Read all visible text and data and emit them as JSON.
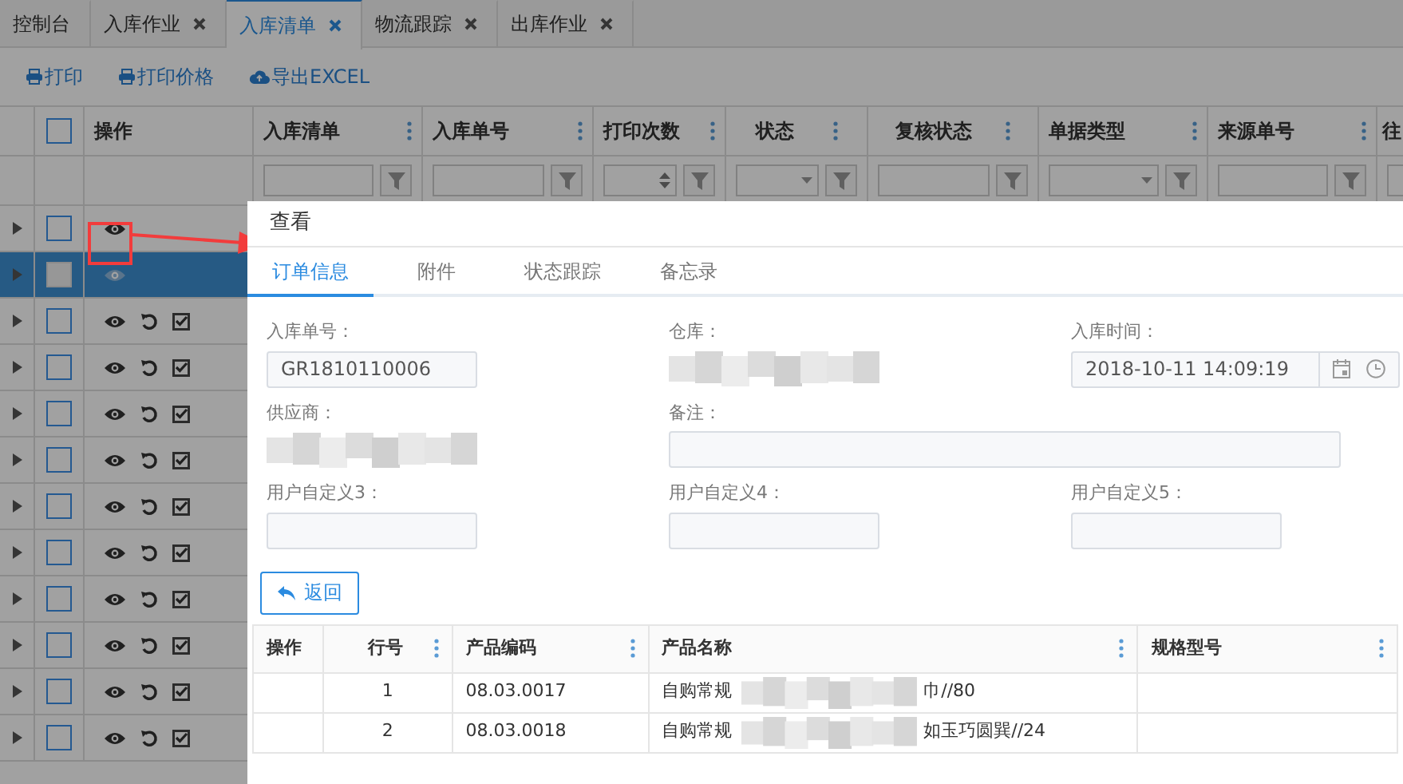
{
  "tabs": [
    {
      "label": "控制台",
      "closable": false,
      "selected": false
    },
    {
      "label": "入库作业",
      "closable": true,
      "selected": false
    },
    {
      "label": "入库清单",
      "closable": true,
      "selected": true
    },
    {
      "label": "物流跟踪",
      "closable": true,
      "selected": false
    },
    {
      "label": "出库作业",
      "closable": true,
      "selected": false
    }
  ],
  "toolbar": [
    {
      "label": "打印",
      "kind": "print"
    },
    {
      "label": "打印价格",
      "kind": "print"
    },
    {
      "label": "导出EXCEL",
      "kind": "export"
    }
  ],
  "grid": {
    "all_checked": false,
    "columns": [
      {
        "label": "操作",
        "kind": "plain"
      },
      {
        "label": "入库清单",
        "kind": "text"
      },
      {
        "label": "入库单号",
        "kind": "text"
      },
      {
        "label": "打印次数",
        "kind": "number"
      },
      {
        "label": "状态",
        "kind": "select"
      },
      {
        "label": "复核状态",
        "kind": "text"
      },
      {
        "label": "单据类型",
        "kind": "select"
      },
      {
        "label": "来源单号",
        "kind": "text"
      },
      {
        "label": "往",
        "kind": "text"
      }
    ],
    "rows": [
      {
        "kind": "view_only",
        "selected": false,
        "highlighted": true
      },
      {
        "kind": "view_only",
        "selected": true,
        "highlighted": false
      },
      {
        "kind": "full",
        "selected": false,
        "highlighted": false
      },
      {
        "kind": "full",
        "selected": false,
        "highlighted": false
      },
      {
        "kind": "full",
        "selected": false,
        "highlighted": false
      },
      {
        "kind": "full",
        "selected": false,
        "highlighted": false
      },
      {
        "kind": "full",
        "selected": false,
        "highlighted": false
      },
      {
        "kind": "full",
        "selected": false,
        "highlighted": false
      },
      {
        "kind": "full",
        "selected": false,
        "highlighted": false
      },
      {
        "kind": "full",
        "selected": false,
        "highlighted": false
      },
      {
        "kind": "full",
        "selected": false,
        "highlighted": false
      },
      {
        "kind": "full",
        "selected": false,
        "highlighted": false
      }
    ]
  },
  "dialog": {
    "title": "查看",
    "tabs": [
      {
        "label": "订单信息",
        "selected": true
      },
      {
        "label": "附件",
        "selected": false
      },
      {
        "label": "状态跟踪",
        "selected": false
      },
      {
        "label": "备忘录",
        "selected": false
      }
    ],
    "fields": [
      {
        "label": "入库单号：",
        "kind": "text",
        "value": "GR1810110006"
      },
      {
        "label": "仓库：",
        "kind": "redacted"
      },
      {
        "label": "入库时间：",
        "kind": "datetime",
        "value": "2018-10-11 14:09:19"
      },
      {
        "label": "供应商：",
        "kind": "redacted"
      },
      {
        "label": "备注：",
        "kind": "wide"
      },
      {
        "label": "用户自定义3：",
        "kind": "text"
      },
      {
        "label": "用户自定义4：",
        "kind": "text"
      },
      {
        "label": "用户自定义5：",
        "kind": "text"
      }
    ],
    "back_button": "返回",
    "table": {
      "columns": [
        "操作",
        "行号",
        "产品编码",
        "产品名称",
        "规格型号"
      ],
      "rows": [
        {
          "line": "1",
          "code": "08.03.0017",
          "name_start": "自购常规",
          "name_end": "巾//80"
        },
        {
          "line": "2",
          "code": "08.03.0018",
          "name_start": "自购常规",
          "name_end": "如玉巧圆巽//24"
        }
      ]
    }
  }
}
